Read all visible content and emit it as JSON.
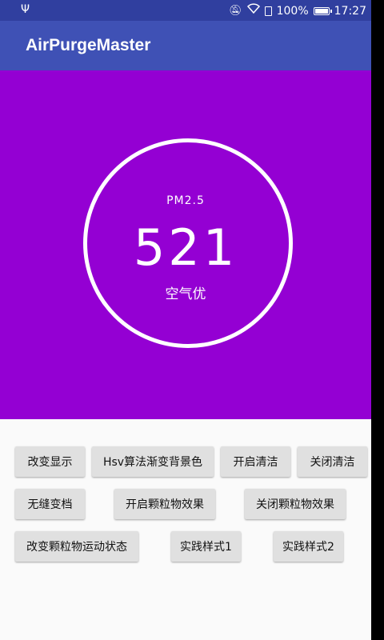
{
  "status_bar": {
    "battery_text": "100%",
    "time": "17:27",
    "icons": [
      "usb-icon",
      "mute-icon",
      "wifi-icon",
      "sim-icon",
      "battery-icon"
    ]
  },
  "app_bar": {
    "title": "AirPurgeMaster"
  },
  "gauge": {
    "label": "PM2.5",
    "value": "521",
    "quality": "空气优"
  },
  "buttons": {
    "row1": [
      "改变显示",
      "Hsv算法渐变背景色",
      "开启清洁",
      "关闭清洁"
    ],
    "row2": [
      "无缝变档",
      "开启颗粒物效果",
      "关闭颗粒物效果"
    ],
    "row3": [
      "改变颗粒物运动状态",
      "实践样式1",
      "实践样式2"
    ]
  },
  "colors": {
    "status_bar": "#303F9F",
    "app_bar": "#3F51B5",
    "gauge_background": "#9400D3",
    "button": "#E0E0E0"
  }
}
